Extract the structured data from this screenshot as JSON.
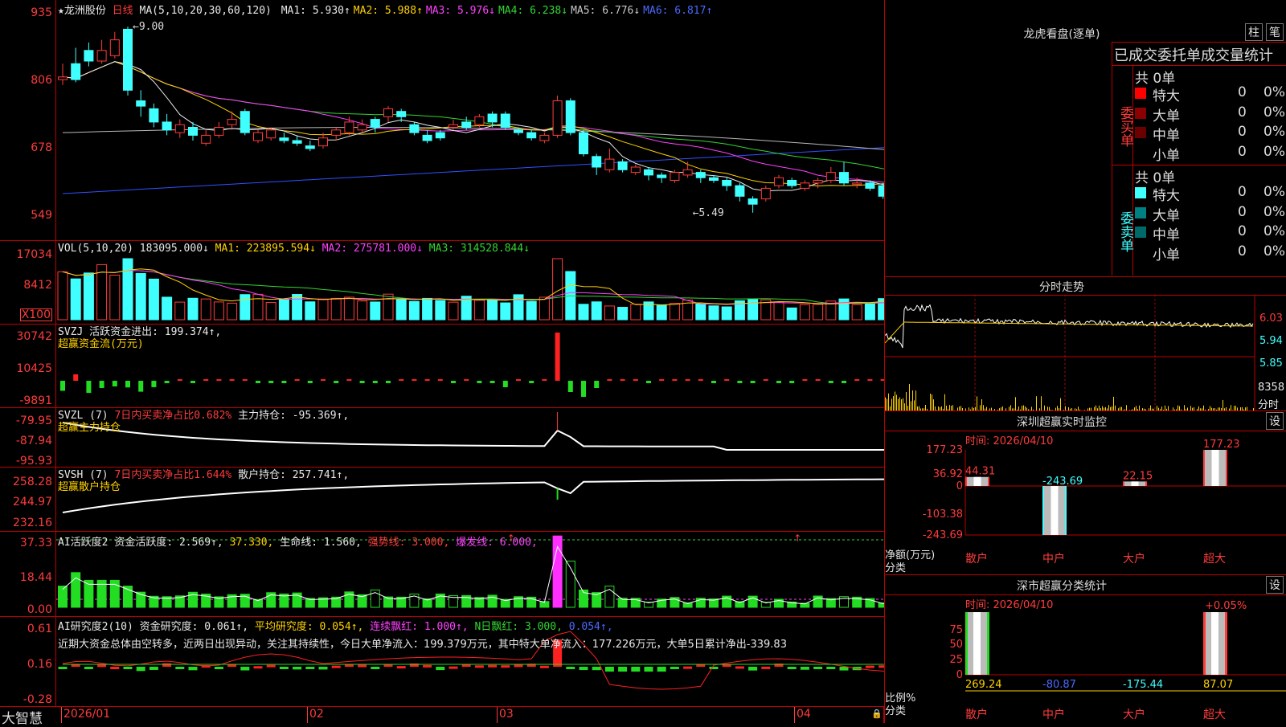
{
  "main": {
    "stock_name": "★龙洲股份",
    "period": "日线",
    "ma_head": "MA(5,10,20,30,60,120)",
    "ma": [
      {
        "label": "MA1: 5.930↑",
        "color": "#e8e8e8"
      },
      {
        "label": "MA2: 5.988↑",
        "color": "#ffd200"
      },
      {
        "label": "MA3: 5.976↓",
        "color": "#ff40ff"
      },
      {
        "label": "MA4: 6.238↓",
        "color": "#32d632"
      },
      {
        "label": "MA5: 6.776↓",
        "color": "#c8c8c8"
      },
      {
        "label": "MA6: 6.817↑",
        "color": "#4a6aff"
      }
    ],
    "y_labels": [
      "935",
      "806",
      "678",
      "549"
    ],
    "high_mark": "9.00",
    "low_mark": "5.49",
    "candles": [
      {
        "o": 8.0,
        "c": 8.05,
        "h": 8.3,
        "l": 7.9
      },
      {
        "o": 8.3,
        "c": 8.0,
        "h": 8.6,
        "l": 7.95
      },
      {
        "o": 8.55,
        "c": 8.35,
        "h": 8.7,
        "l": 8.25
      },
      {
        "o": 8.35,
        "c": 8.55,
        "h": 8.75,
        "l": 8.3
      },
      {
        "o": 8.45,
        "c": 8.75,
        "h": 8.9,
        "l": 8.4
      },
      {
        "o": 8.95,
        "c": 7.8,
        "h": 9.0,
        "l": 7.7
      },
      {
        "o": 7.6,
        "c": 7.5,
        "h": 7.8,
        "l": 7.3
      },
      {
        "o": 7.45,
        "c": 7.2,
        "h": 7.55,
        "l": 7.1
      },
      {
        "o": 7.2,
        "c": 7.05,
        "h": 7.35,
        "l": 6.95
      },
      {
        "o": 7.0,
        "c": 7.15,
        "h": 7.25,
        "l": 6.9
      },
      {
        "o": 7.1,
        "c": 6.95,
        "h": 7.2,
        "l": 6.85
      },
      {
        "o": 6.8,
        "c": 6.95,
        "h": 7.05,
        "l": 6.75
      },
      {
        "o": 6.95,
        "c": 7.1,
        "h": 7.2,
        "l": 6.9
      },
      {
        "o": 7.15,
        "c": 7.25,
        "h": 7.4,
        "l": 7.05
      },
      {
        "o": 7.4,
        "c": 7.0,
        "h": 7.45,
        "l": 6.95
      },
      {
        "o": 6.85,
        "c": 7.0,
        "h": 7.05,
        "l": 6.8
      },
      {
        "o": 6.9,
        "c": 7.05,
        "h": 7.1,
        "l": 6.85
      },
      {
        "o": 6.9,
        "c": 6.85,
        "h": 7.0,
        "l": 6.8
      },
      {
        "o": 6.85,
        "c": 6.8,
        "h": 6.95,
        "l": 6.75
      },
      {
        "o": 6.75,
        "c": 6.7,
        "h": 6.85,
        "l": 6.65
      },
      {
        "o": 6.75,
        "c": 6.9,
        "h": 7.0,
        "l": 6.7
      },
      {
        "o": 6.95,
        "c": 7.05,
        "h": 7.1,
        "l": 6.85
      },
      {
        "o": 7.0,
        "c": 7.2,
        "h": 7.3,
        "l": 6.95
      },
      {
        "o": 7.05,
        "c": 7.15,
        "h": 7.25,
        "l": 7.0
      },
      {
        "o": 7.25,
        "c": 7.1,
        "h": 7.3,
        "l": 7.0
      },
      {
        "o": 7.3,
        "c": 7.45,
        "h": 7.5,
        "l": 7.2
      },
      {
        "o": 7.4,
        "c": 7.3,
        "h": 7.45,
        "l": 7.2
      },
      {
        "o": 7.15,
        "c": 7.0,
        "h": 7.2,
        "l": 6.95
      },
      {
        "o": 6.95,
        "c": 6.85,
        "h": 7.05,
        "l": 6.8
      },
      {
        "o": 7.0,
        "c": 6.9,
        "h": 7.05,
        "l": 6.85
      },
      {
        "o": 7.1,
        "c": 7.15,
        "h": 7.25,
        "l": 7.05
      },
      {
        "o": 7.2,
        "c": 7.1,
        "h": 7.3,
        "l": 7.05
      },
      {
        "o": 7.15,
        "c": 7.3,
        "h": 7.35,
        "l": 7.1
      },
      {
        "o": 7.35,
        "c": 7.2,
        "h": 7.4,
        "l": 7.1
      },
      {
        "o": 7.35,
        "c": 7.1,
        "h": 7.4,
        "l": 7.05
      },
      {
        "o": 7.05,
        "c": 7.0,
        "h": 7.1,
        "l": 6.95
      },
      {
        "o": 7.0,
        "c": 6.9,
        "h": 7.05,
        "l": 6.85
      },
      {
        "o": 6.85,
        "c": 6.95,
        "h": 7.0,
        "l": 6.8
      },
      {
        "o": 6.95,
        "c": 7.6,
        "h": 7.7,
        "l": 6.9
      },
      {
        "o": 7.6,
        "c": 7.0,
        "h": 7.65,
        "l": 6.95
      },
      {
        "o": 7.0,
        "c": 6.6,
        "h": 7.05,
        "l": 6.55
      },
      {
        "o": 6.55,
        "c": 6.35,
        "h": 6.6,
        "l": 6.2
      },
      {
        "o": 6.3,
        "c": 6.5,
        "h": 6.7,
        "l": 6.25
      },
      {
        "o": 6.45,
        "c": 6.3,
        "h": 6.5,
        "l": 6.25
      },
      {
        "o": 6.25,
        "c": 6.35,
        "h": 6.4,
        "l": 6.2
      },
      {
        "o": 6.3,
        "c": 6.2,
        "h": 6.35,
        "l": 6.1
      },
      {
        "o": 6.2,
        "c": 6.15,
        "h": 6.25,
        "l": 6.05
      },
      {
        "o": 6.1,
        "c": 6.25,
        "h": 6.3,
        "l": 6.05
      },
      {
        "o": 6.2,
        "c": 6.3,
        "h": 6.45,
        "l": 6.15
      },
      {
        "o": 6.25,
        "c": 6.15,
        "h": 6.3,
        "l": 6.05
      },
      {
        "o": 6.15,
        "c": 6.1,
        "h": 6.2,
        "l": 6.05
      },
      {
        "o": 6.1,
        "c": 6.0,
        "h": 6.15,
        "l": 5.9
      },
      {
        "o": 6.0,
        "c": 5.8,
        "h": 6.05,
        "l": 5.7
      },
      {
        "o": 5.75,
        "c": 5.65,
        "h": 5.8,
        "l": 5.49
      },
      {
        "o": 5.75,
        "c": 5.95,
        "h": 6.0,
        "l": 5.7
      },
      {
        "o": 6.0,
        "c": 6.15,
        "h": 6.2,
        "l": 5.95
      },
      {
        "o": 6.1,
        "c": 6.0,
        "h": 6.15,
        "l": 5.95
      },
      {
        "o": 5.95,
        "c": 6.05,
        "h": 6.1,
        "l": 5.9
      },
      {
        "o": 6.05,
        "c": 6.1,
        "h": 6.15,
        "l": 5.95
      },
      {
        "o": 6.1,
        "c": 6.25,
        "h": 6.35,
        "l": 6.05
      },
      {
        "o": 6.25,
        "c": 6.05,
        "h": 6.45,
        "l": 6.0
      },
      {
        "o": 6.05,
        "c": 6.05,
        "h": 6.15,
        "l": 5.95
      },
      {
        "o": 6.05,
        "c": 5.95,
        "h": 6.1,
        "l": 5.9
      },
      {
        "o": 6.0,
        "c": 5.8,
        "h": 6.05,
        "l": 5.75
      },
      {
        "o": 5.8,
        "c": 6.05,
        "h": 6.1,
        "l": 5.75
      },
      {
        "o": 6.0,
        "c": 6.15,
        "h": 6.2,
        "l": 5.95
      },
      {
        "o": 6.1,
        "c": 6.05,
        "h": 6.15,
        "l": 5.95
      },
      {
        "o": 6.05,
        "c": 6.0,
        "h": 6.1,
        "l": 5.95
      },
      {
        "o": 6.0,
        "c": 6.1,
        "h": 6.15,
        "l": 5.95
      },
      {
        "o": 6.05,
        "c": 6.1,
        "h": 6.15,
        "l": 6.0
      }
    ]
  },
  "vol": {
    "head": "VOL(5,10,20)",
    "val": "183095.000↓",
    "ma1": "MA1: 223895.594↓",
    "ma2": "MA2: 275781.000↓",
    "ma3": "MA3: 314528.844↓",
    "y_labels": [
      "17034",
      "8412"
    ],
    "unit": "X100"
  },
  "svzj": {
    "head": "SVZJ",
    "line1": "活跃资金进出: 199.374↑,",
    "line2": "超赢资金流(万元)",
    "y_labels": [
      "30742",
      "10425",
      "-9891"
    ]
  },
  "svzl": {
    "head": "SVZL (7)",
    "t1": "7日内买卖净占比0.682%",
    "t2": "主力持仓: -95.369↑,",
    "line2": "超赢主力持仓",
    "y_labels": [
      "-79.95",
      "-87.94",
      "-95.93"
    ]
  },
  "svsh": {
    "head": "SVSH (7)",
    "t1": "7日内买卖净占比1.644%",
    "t2": "散户持仓: 257.741↑,",
    "line2": "超赢散户持仓",
    "y_labels": [
      "258.28",
      "244.97",
      "232.16"
    ]
  },
  "ai1": {
    "head": "AI活跃度2",
    "t1": "资金活跃度: 2.569↑,",
    "t2": "37.330,",
    "t3": "生命线: 1.560,",
    "t4": "强势线: 3.000,",
    "t5": "爆发线: 6.000,",
    "y_labels": [
      "37.33",
      "18.44",
      "0.00"
    ]
  },
  "ai2": {
    "head": "AI研究度2(10)",
    "t1": "资金研究度: 0.061↑,",
    "t2": "平均研究度: 0.054↑,",
    "t3": "连续飘红: 1.000↑,",
    "t4": "N日飘红: 3.000,",
    "t5": "0.054↑,",
    "summary": "近期大资金总体由空转多，近两日出现异动，关注其持续性，今日大单净流入：199.379万元，其中特大单净流入：177.226万元，大单5日累计净出-339.83",
    "y_labels": [
      "0.61",
      "0.16",
      "-0.28"
    ]
  },
  "xaxis": {
    "labels": [
      "2026/01",
      "02",
      "03",
      "04"
    ],
    "brand": "大智慧"
  },
  "lhb": {
    "title": "龙虎看盘(逐单)",
    "btn1": "柱",
    "btn2": "笔",
    "subtitle": "已成交委托单成交量统计",
    "buy_side": "委买单",
    "sell_side": "委卖单",
    "buy_total": "共 0单",
    "sell_total": "共 0单",
    "buy_rows": [
      {
        "name": "特大",
        "val": "0",
        "pct": "0%",
        "color": "#ff0000"
      },
      {
        "name": "大单",
        "val": "0",
        "pct": "0%",
        "color": "#8b0000"
      },
      {
        "name": "中单",
        "val": "0",
        "pct": "0%",
        "color": "#6a0000"
      },
      {
        "name": "小单",
        "val": "0",
        "pct": "0%",
        "color": ""
      }
    ],
    "sell_rows": [
      {
        "name": "特大",
        "val": "0",
        "pct": "0%",
        "color": "#40ffff"
      },
      {
        "name": "大单",
        "val": "0",
        "pct": "0%",
        "color": "#008080"
      },
      {
        "name": "中单",
        "val": "0",
        "pct": "0%",
        "color": "#006a6a"
      },
      {
        "name": "小单",
        "val": "0",
        "pct": "0%",
        "color": ""
      }
    ]
  },
  "fs": {
    "title": "分时走势",
    "y_labels": [
      "6.03",
      "5.94",
      "5.85"
    ],
    "vol_label": "8358",
    "vol_unit": "分时"
  },
  "sz_mon": {
    "title": "深圳超赢实时监控",
    "btn": "设",
    "time": "时间: 2026/04/10",
    "y_labels": [
      "177.23",
      "36.92",
      "0",
      "-103.38",
      "-243.69"
    ],
    "cats": [
      "散户",
      "中户",
      "大户",
      "超大"
    ],
    "values": [
      44.31,
      -243.69,
      22.15,
      177.23
    ],
    "value_labels": [
      "44.31",
      "-243.69",
      "22.15",
      "177.23"
    ],
    "ylabel1": "净额(万元)",
    "ylabel2": "分类"
  },
  "sz_cls": {
    "title": "深市超赢分类统计",
    "btn": "设",
    "time": "时间: 2026/04/10",
    "y_labels": [
      "75",
      "50",
      "25",
      "0"
    ],
    "cats": [
      "散户",
      "中户",
      "大户",
      "超大"
    ],
    "pct_label": "+0.05%",
    "bottom_vals": [
      "269.24",
      "-80.87",
      "-175.44",
      "87.07"
    ],
    "ylabel1": "比例%",
    "ylabel2": "分类"
  }
}
